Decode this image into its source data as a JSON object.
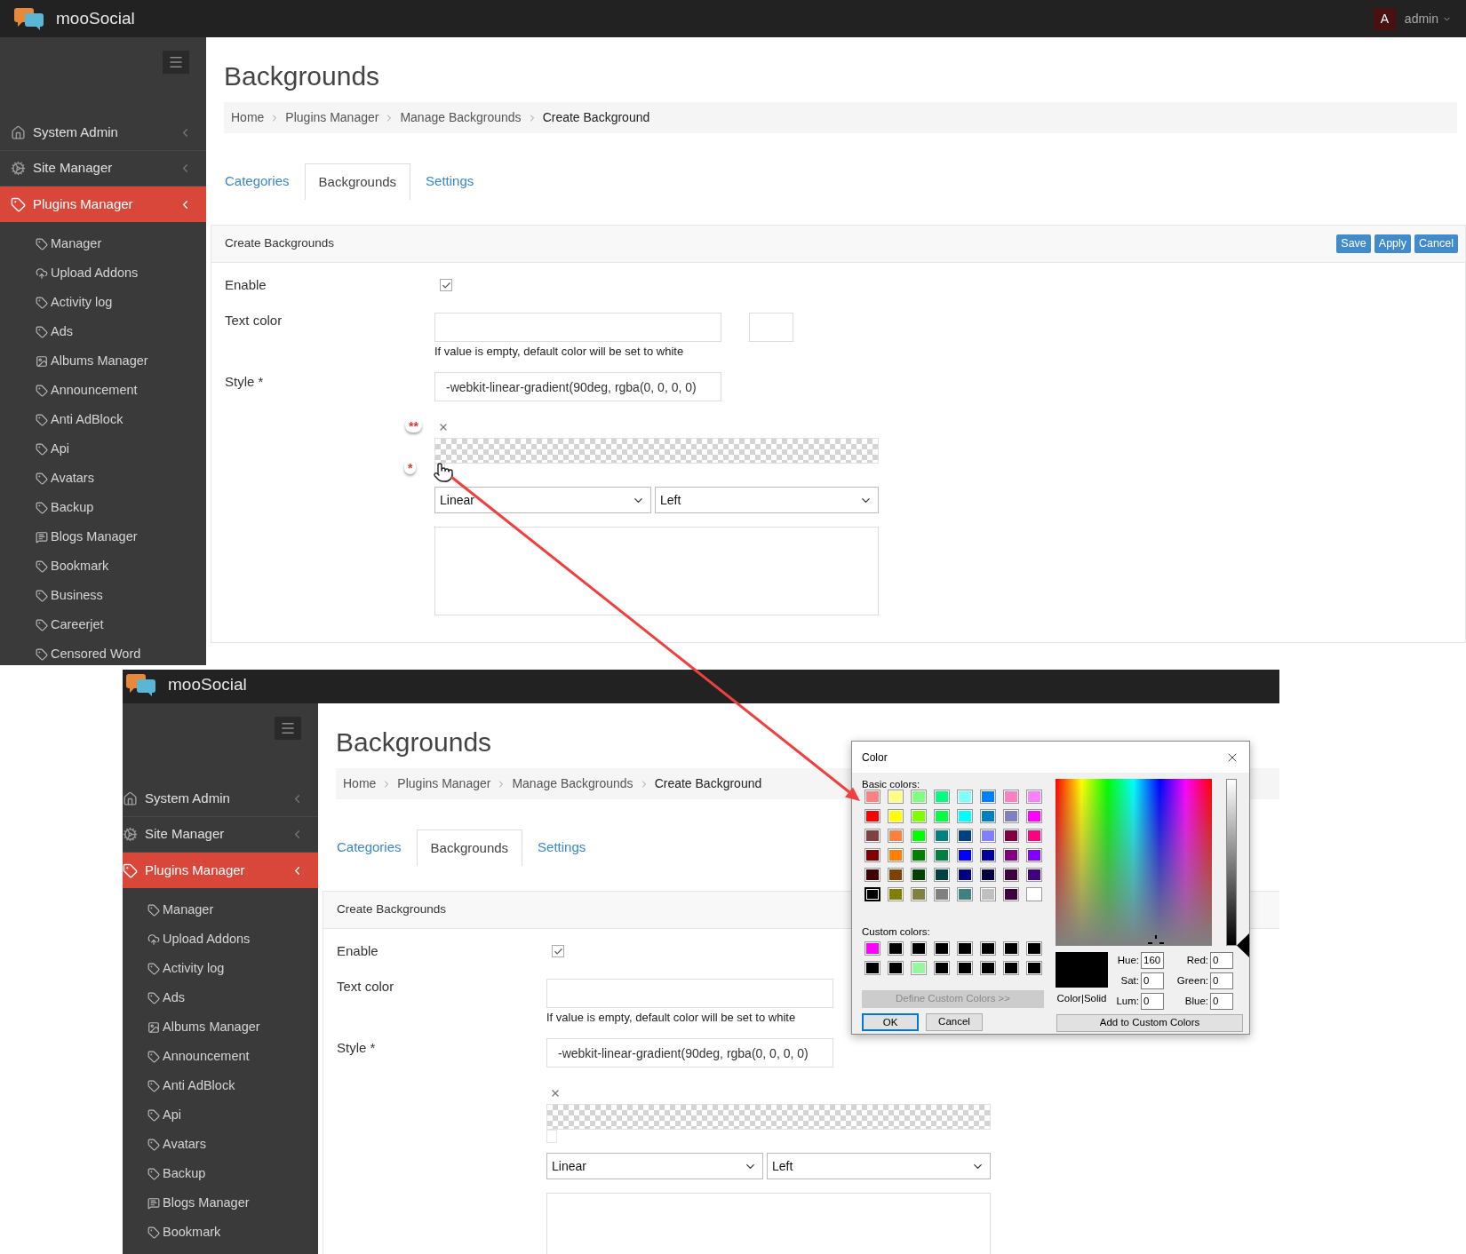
{
  "screens": [
    {
      "brand": "mooSocial",
      "user": {
        "initial": "A",
        "name": "admin"
      },
      "menu": [
        {
          "label": "System Admin",
          "active": false
        },
        {
          "label": "Site Manager",
          "active": false
        },
        {
          "label": "Plugins Manager",
          "active": true
        }
      ],
      "submenu": [
        "Manager",
        "Upload Addons",
        "Activity log",
        "Ads",
        "Albums Manager",
        "Announcement",
        "Anti AdBlock",
        "Api",
        "Avatars",
        "Backup",
        "Blogs Manager",
        "Bookmark",
        "Business",
        "Careerjet",
        "Censored Word"
      ],
      "title": "Backgrounds",
      "breadcrumb": [
        "Home",
        "Plugins Manager",
        "Manage Backgrounds",
        "Create Background"
      ],
      "tabs": [
        {
          "label": "Categories",
          "selected": false
        },
        {
          "label": "Backgrounds",
          "selected": true
        },
        {
          "label": "Settings",
          "selected": false
        }
      ],
      "panel": {
        "title": "Create Backgrounds",
        "buttons": [
          "Save",
          "Apply",
          "Cancel"
        ]
      },
      "form": {
        "enable": {
          "label": "Enable",
          "checked": true
        },
        "text_color": {
          "label": "Text color",
          "hint": "If value is empty, default color will be set to white"
        },
        "style": {
          "label": "Style *",
          "value": "-webkit-linear-gradient(90deg, rgba(0, 0, 0, 0)"
        },
        "gradient": {
          "markers": [
            "**",
            "*"
          ],
          "type": "Linear",
          "direction": "Left"
        }
      }
    },
    {
      "brand": "mooSocial",
      "menu": [
        {
          "label": "System Admin",
          "active": false
        },
        {
          "label": "Site Manager",
          "active": false
        },
        {
          "label": "Plugins Manager",
          "active": true
        }
      ],
      "submenu": [
        "Manager",
        "Upload Addons",
        "Activity log",
        "Ads",
        "Albums Manager",
        "Announcement",
        "Anti AdBlock",
        "Api",
        "Avatars",
        "Backup",
        "Blogs Manager",
        "Bookmark"
      ],
      "title": "Backgrounds",
      "breadcrumb": [
        "Home",
        "Plugins Manager",
        "Manage Backgrounds",
        "Create Background"
      ],
      "tabs": [
        {
          "label": "Categories",
          "selected": false
        },
        {
          "label": "Backgrounds",
          "selected": true
        },
        {
          "label": "Settings",
          "selected": false
        }
      ],
      "panel": {
        "title": "Create Backgrounds"
      },
      "form": {
        "enable": {
          "label": "Enable",
          "checked": true
        },
        "text_color": {
          "label": "Text color",
          "hint": "If value is empty, default color will be set to white"
        },
        "style": {
          "label": "Style *",
          "value": "-webkit-linear-gradient(90deg, rgba(0, 0, 0, 0)"
        },
        "gradient": {
          "type": "Linear",
          "direction": "Left"
        }
      }
    }
  ],
  "color_dialog": {
    "title": "Color",
    "basic_label": "Basic colors:",
    "basic_colors": [
      [
        {
          "color": "#ff8080",
          "selected": false
        },
        {
          "color": "#ffff80",
          "selected": false
        },
        {
          "color": "#80ff80",
          "selected": false
        },
        {
          "color": "#00ff80",
          "selected": false
        },
        {
          "color": "#80ffff",
          "selected": false
        },
        {
          "color": "#0080ff",
          "selected": false
        },
        {
          "color": "#ff80c0",
          "selected": false
        },
        {
          "color": "#ff80ff",
          "selected": false
        }
      ],
      [
        {
          "color": "#ff0000",
          "selected": false
        },
        {
          "color": "#ffff00",
          "selected": false
        },
        {
          "color": "#80ff00",
          "selected": false
        },
        {
          "color": "#00ff40",
          "selected": false
        },
        {
          "color": "#00ffff",
          "selected": false
        },
        {
          "color": "#0080c0",
          "selected": false
        },
        {
          "color": "#8080c0",
          "selected": false
        },
        {
          "color": "#ff00ff",
          "selected": false
        }
      ],
      [
        {
          "color": "#804040",
          "selected": false
        },
        {
          "color": "#ff8040",
          "selected": false
        },
        {
          "color": "#00ff00",
          "selected": false
        },
        {
          "color": "#008080",
          "selected": false
        },
        {
          "color": "#004080",
          "selected": false
        },
        {
          "color": "#8080ff",
          "selected": false
        },
        {
          "color": "#800040",
          "selected": false
        },
        {
          "color": "#ff0080",
          "selected": false
        }
      ],
      [
        {
          "color": "#800000",
          "selected": false
        },
        {
          "color": "#ff8000",
          "selected": false
        },
        {
          "color": "#008000",
          "selected": false
        },
        {
          "color": "#008040",
          "selected": false
        },
        {
          "color": "#0000ff",
          "selected": false
        },
        {
          "color": "#0000a0",
          "selected": false
        },
        {
          "color": "#800080",
          "selected": false
        },
        {
          "color": "#8000ff",
          "selected": false
        }
      ],
      [
        {
          "color": "#400000",
          "selected": false
        },
        {
          "color": "#804000",
          "selected": false
        },
        {
          "color": "#004000",
          "selected": false
        },
        {
          "color": "#004040",
          "selected": false
        },
        {
          "color": "#000080",
          "selected": false
        },
        {
          "color": "#000040",
          "selected": false
        },
        {
          "color": "#400040",
          "selected": false
        },
        {
          "color": "#400080",
          "selected": false
        }
      ],
      [
        {
          "color": "#000000",
          "selected": true
        },
        {
          "color": "#808000",
          "selected": false
        },
        {
          "color": "#808040",
          "selected": false
        },
        {
          "color": "#808080",
          "selected": false
        },
        {
          "color": "#408080",
          "selected": false
        },
        {
          "color": "#c0c0c0",
          "selected": false
        },
        {
          "color": "#400040",
          "selected": false
        },
        {
          "color": "#ffffff",
          "selected": false
        }
      ]
    ],
    "custom_label": "Custom colors:",
    "custom_colors": [
      [
        {
          "color": "#ff00ff"
        },
        {
          "color": "#000000"
        },
        {
          "color": "#000000"
        },
        {
          "color": "#000000"
        },
        {
          "color": "#000000"
        },
        {
          "color": "#000000"
        },
        {
          "color": "#000000"
        },
        {
          "color": "#000000"
        }
      ],
      [
        {
          "color": "#000000"
        },
        {
          "color": "#000000"
        },
        {
          "color": "#98f5a0"
        },
        {
          "color": "#000000"
        },
        {
          "color": "#000000"
        },
        {
          "color": "#000000"
        },
        {
          "color": "#000000"
        },
        {
          "color": "#000000"
        }
      ]
    ],
    "define_button": {
      "label": "Define Custom Colors >>",
      "disabled": true
    },
    "ok": "OK",
    "cancel": "Cancel",
    "preview_label": "Color|Solid",
    "fields": [
      {
        "label": "Hue:",
        "value": "160"
      },
      {
        "label": "Sat:",
        "value": "0"
      },
      {
        "label": "Lum:",
        "value": "0"
      },
      {
        "label": "Red:",
        "value": "0"
      },
      {
        "label": "Green:",
        "value": "0"
      },
      {
        "label": "Blue:",
        "value": "0"
      }
    ],
    "add_button": "Add to Custom Colors"
  }
}
